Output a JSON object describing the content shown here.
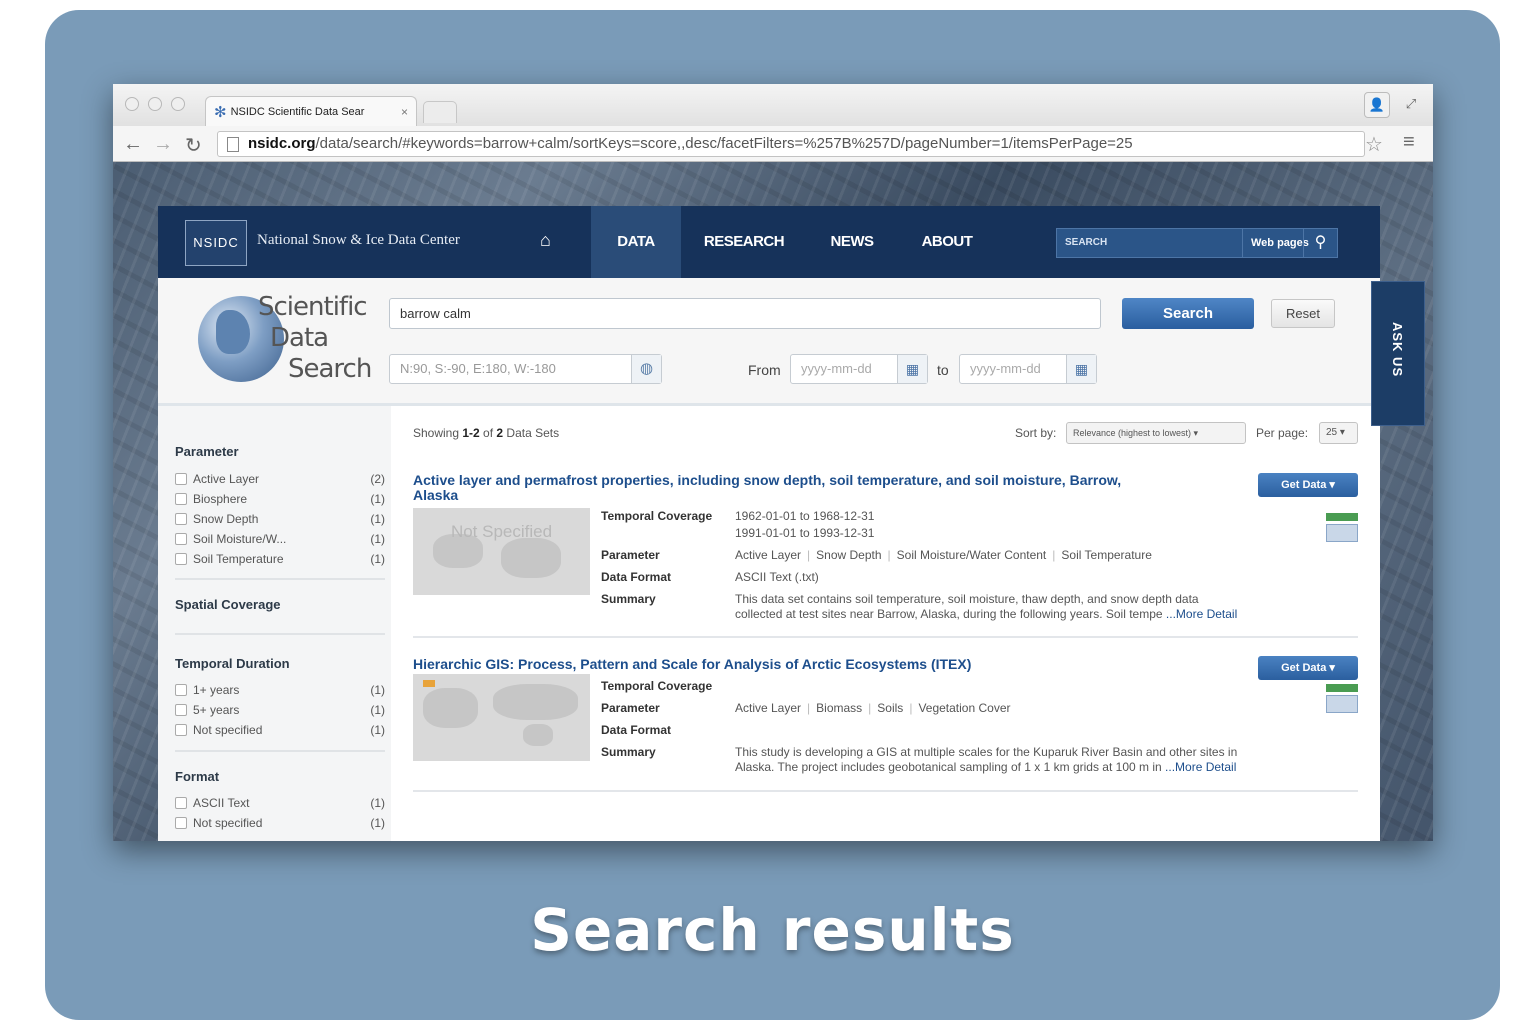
{
  "caption": "Search results",
  "browser": {
    "tab_title": "NSIDC Scientific Data Sear",
    "tab_close": "×",
    "url_host": "nsidc.org",
    "url_path": "/data/search/#keywords=barrow+calm/sortKeys=score,,desc/facetFilters=%257B%257D/pageNumber=1/itemsPerPage=25"
  },
  "site": {
    "logo_text": "NSIDC",
    "org_name": "National Snow & Ice Data Center",
    "nav": [
      {
        "label": "DATA"
      },
      {
        "label": "RESEARCH"
      },
      {
        "label": "NEWS"
      },
      {
        "label": "ABOUT"
      }
    ],
    "site_search_placeholder": "SEARCH",
    "site_search_scope": "Web pages",
    "ask_us": "ASK US"
  },
  "search": {
    "brand": [
      "Scientific",
      "Data",
      "Search"
    ],
    "keywords": "barrow calm",
    "search_label": "Search",
    "reset_label": "Reset",
    "bbox_placeholder": "N:90, S:-90, E:180, W:-180",
    "from_label": "From",
    "to_label": "to",
    "date_placeholder": "yyyy-mm-dd"
  },
  "facets": {
    "parameter": {
      "title": "Parameter",
      "items": [
        {
          "label": "Active Layer",
          "count": "(2)"
        },
        {
          "label": "Biosphere",
          "count": "(1)"
        },
        {
          "label": "Snow Depth",
          "count": "(1)"
        },
        {
          "label": "Soil Moisture/W...",
          "count": "(1)"
        },
        {
          "label": "Soil Temperature",
          "count": "(1)"
        }
      ]
    },
    "spatial": {
      "title": "Spatial Coverage"
    },
    "temporal": {
      "title": "Temporal Duration",
      "items": [
        {
          "label": "1+ years",
          "count": "(1)"
        },
        {
          "label": "5+ years",
          "count": "(1)"
        },
        {
          "label": "Not specified",
          "count": "(1)"
        }
      ]
    },
    "format": {
      "title": "Format",
      "items": [
        {
          "label": "ASCII Text",
          "count": "(1)"
        },
        {
          "label": "Not specified",
          "count": "(1)"
        }
      ]
    }
  },
  "results": {
    "showing_prefix": "Showing ",
    "showing_range": "1-2",
    "showing_of": " of ",
    "showing_total": "2",
    "showing_suffix": " Data Sets",
    "sort_label": "Sort by:",
    "sort_value": "Relevance (highest to lowest) ▾",
    "per_page_label": "Per page:",
    "per_page_value": "25 ▾",
    "get_data_label": "Get Data ▾",
    "labels": {
      "temporal": "Temporal Coverage",
      "parameter": "Parameter",
      "format": "Data Format",
      "summary": "Summary"
    },
    "more_detail": "...More Detail",
    "items": [
      {
        "title_line1": "Active layer and permafrost properties, including snow depth, soil temperature, and soil moisture, Barrow,",
        "title_line2": "Alaska",
        "thumb_text": "Not Specified",
        "temporal_1": "1962-01-01 to 1968-12-31",
        "temporal_2": "1991-01-01 to 1993-12-31",
        "parameters": [
          "Active Layer",
          "Snow Depth",
          "Soil Moisture/Water Content",
          "Soil Temperature"
        ],
        "format": "ASCII Text (.txt)",
        "summary_1": "This data set contains soil temperature, soil moisture, thaw depth, and snow depth data",
        "summary_2": "collected at test sites near Barrow, Alaska, during the following years. Soil tempe"
      },
      {
        "title_line1": "Hierarchic GIS: Process, Pattern and Scale for Analysis of Arctic Ecosystems (ITEX)",
        "parameters": [
          "Active Layer",
          "Biomass",
          "Soils",
          "Vegetation Cover"
        ],
        "summary_1": "This study is developing a GIS at multiple scales for the Kuparuk River Basin and other sites in",
        "summary_2": "Alaska. The project includes geobotanical sampling of 1 x 1 km grids at 100 m in"
      }
    ]
  }
}
